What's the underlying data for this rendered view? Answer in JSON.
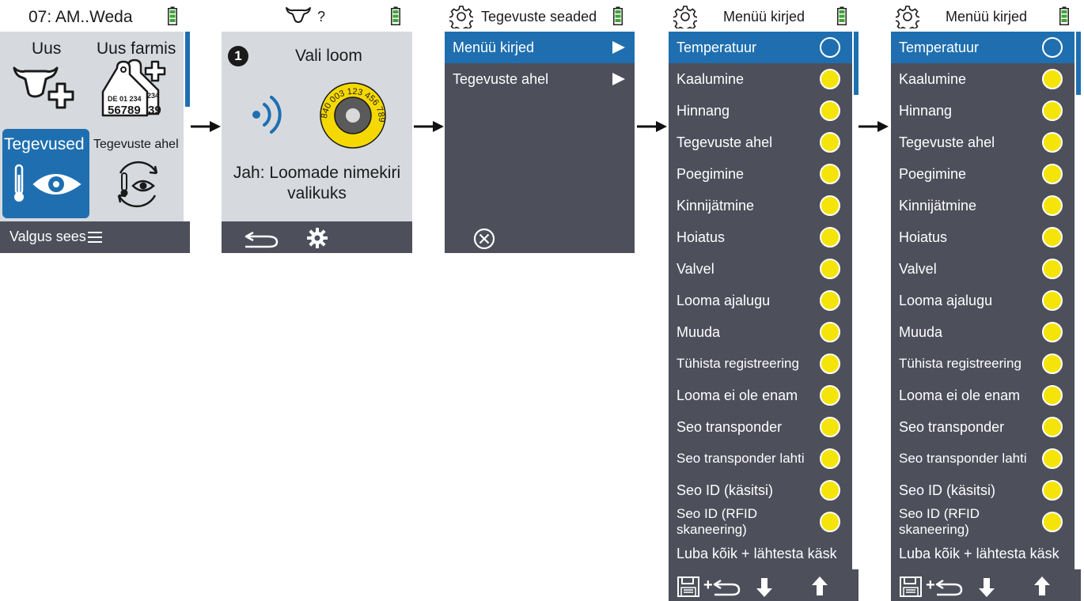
{
  "screen1": {
    "status_title": "07: AM..Weda",
    "tiles": [
      {
        "label": "Uus",
        "icon": "cow-add-icon"
      },
      {
        "label": "Uus farmis",
        "icon": "eartag-add-icon",
        "tag_text_small": "DE 01 234",
        "tag_text_big": "56789",
        "tag_back_small": "234",
        "tag_back_big": "39"
      },
      {
        "label": "Tegevused",
        "icon": "thermometer-eye-icon"
      },
      {
        "label": "Tegevuste ahel",
        "icon": "activity-cycle-icon"
      }
    ],
    "footer_label": "Valgus sees"
  },
  "screen2": {
    "status_title": "?",
    "step_number": "1",
    "prompt": "Vali loom",
    "tag_number": "840 003 123 456 789",
    "hint_line1": "Jah: Loomade nimekiri",
    "hint_line2": "valikuks"
  },
  "screen3": {
    "title": "Tegevuste seaded",
    "items": [
      "Menüü kirjed",
      "Tegevuste ahel"
    ]
  },
  "screen4": {
    "title": "Menüü kirjed",
    "items": [
      "Temperatuur",
      "Kaalumine",
      "Hinnang",
      "Tegevuste ahel",
      "Poegimine",
      "Kinnijätmine",
      "Hoiatus",
      "Valvel",
      "Looma ajalugu",
      "Muuda",
      "Tühista registreering",
      "Looma ei ole enam",
      "Seo transponder",
      "Seo transponder lahti",
      "Seo ID (käsitsi)",
      "Seo ID (RFID skaneering)",
      "Luba kõik + lähtesta käsk"
    ],
    "footer_plus": "+"
  },
  "screen5": {
    "title": "Menüü kirjed",
    "items": [
      "Temperatuur",
      "Kaalumine",
      "Hinnang",
      "Tegevuste ahel",
      "Poegimine",
      "Kinnijätmine",
      "Hoiatus",
      "Valvel",
      "Looma ajalugu",
      "Muuda",
      "Tühista registreering",
      "Looma ei ole enam",
      "Seo transponder",
      "Seo transponder lahti",
      "Seo ID (käsitsi)",
      "Seo ID (RFID skaneering)",
      "Luba kõik + lähtesta käsk"
    ],
    "footer_plus": "+"
  },
  "colors": {
    "accent": "#1f6fb0",
    "panel": "#4d4f5b",
    "screen_bg": "#d6dadf",
    "dot": "#f5e40a",
    "battery": "#3fa535"
  }
}
